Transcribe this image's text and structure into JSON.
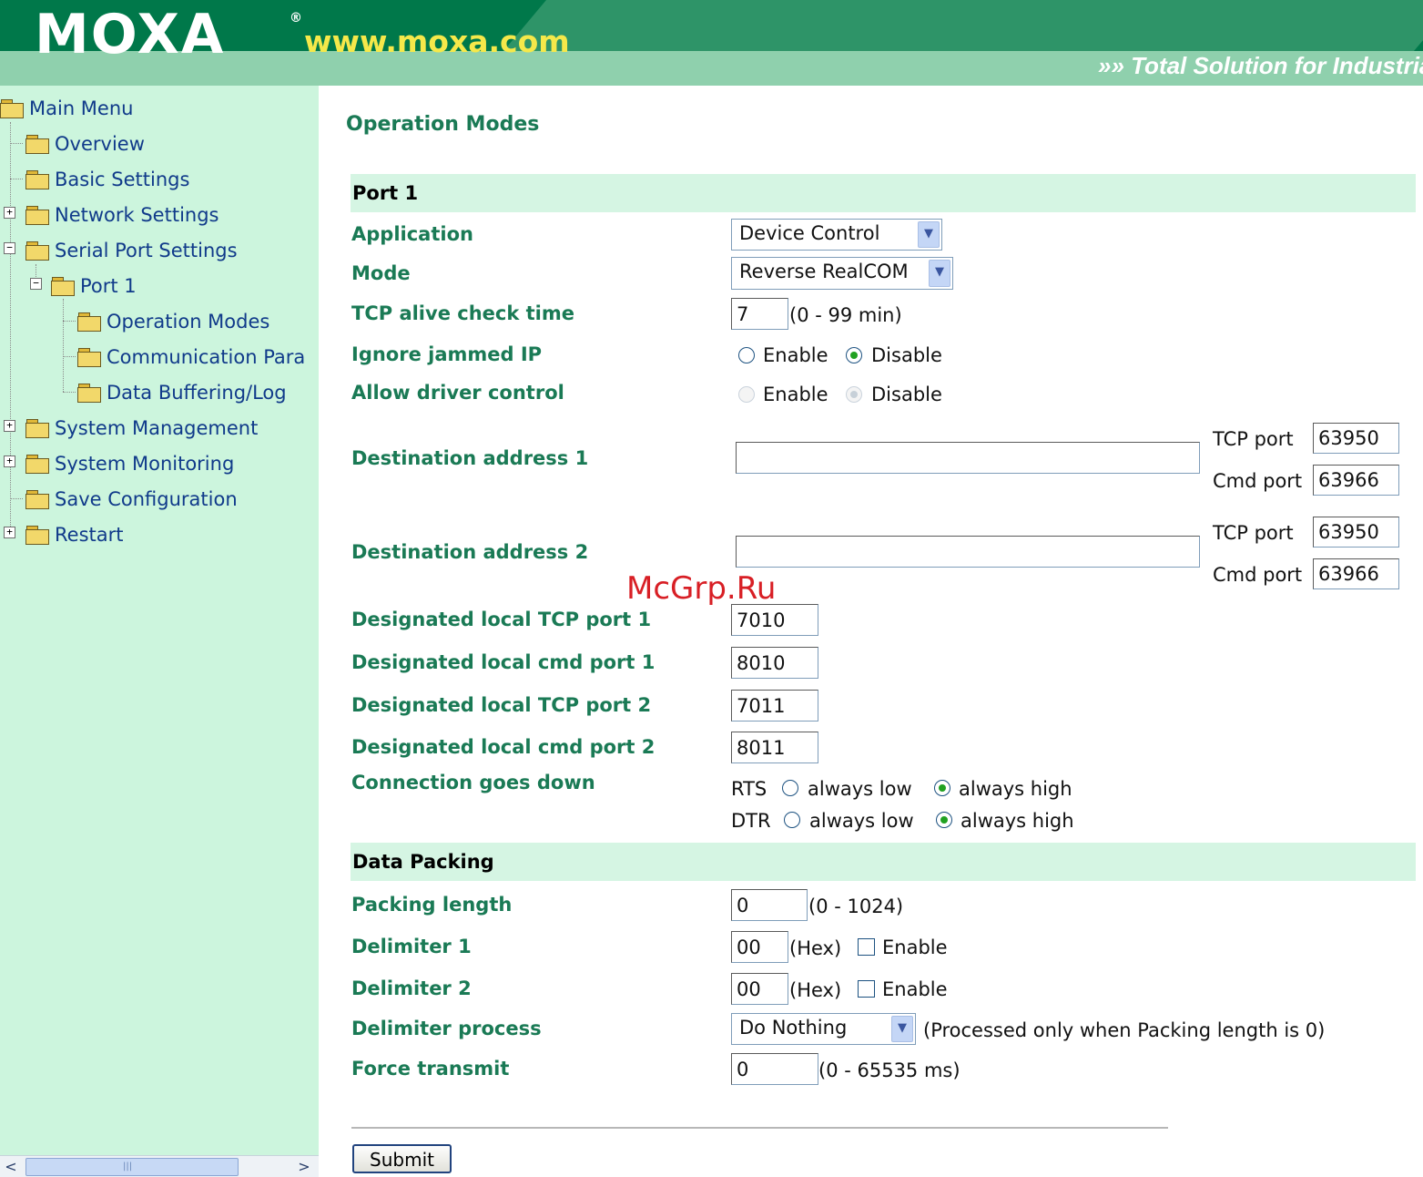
{
  "header": {
    "logo": "MOXA",
    "registered_mark": "®",
    "site_url": "www.moxa.com",
    "slogan": "»» Total Solution for Industrial"
  },
  "sidebar": {
    "items": [
      {
        "label": "Main Menu"
      },
      {
        "label": "Overview"
      },
      {
        "label": "Basic Settings"
      },
      {
        "label": "Network Settings"
      },
      {
        "label": "Serial Port Settings"
      },
      {
        "label": "Port 1"
      },
      {
        "label": "Operation Modes"
      },
      {
        "label": "Communication Para"
      },
      {
        "label": "Data Buffering/Log"
      },
      {
        "label": "System Management"
      },
      {
        "label": "System Monitoring"
      },
      {
        "label": "Save Configuration"
      },
      {
        "label": "Restart"
      }
    ],
    "expand_symbol": "+",
    "collapse_symbol": "−",
    "scroll_left": "<",
    "scroll_right": ">",
    "scroll_grip": "|||"
  },
  "main": {
    "title": "Operation Modes",
    "port_section": "Port 1",
    "application": {
      "label": "Application",
      "value": "Device Control"
    },
    "mode": {
      "label": "Mode",
      "value": "Reverse RealCOM"
    },
    "tcp_alive": {
      "label": "TCP alive check time",
      "value": "7",
      "hint": "(0 - 99 min)"
    },
    "ignore_jammed": {
      "label": "Ignore jammed IP",
      "opt1": "Enable",
      "opt2": "Disable",
      "selected": "Disable"
    },
    "allow_driver": {
      "label": "Allow driver control",
      "opt1": "Enable",
      "opt2": "Disable",
      "selected": "Disable",
      "disabled": true
    },
    "dest1": {
      "label": "Destination address 1",
      "value": "",
      "tcp_label": "TCP port",
      "tcp_value": "63950",
      "cmd_label": "Cmd port",
      "cmd_value": "63966"
    },
    "dest2": {
      "label": "Destination address 2",
      "value": "",
      "tcp_label": "TCP port",
      "tcp_value": "63950",
      "cmd_label": "Cmd port",
      "cmd_value": "63966"
    },
    "local_tcp1": {
      "label": "Designated local TCP port 1",
      "value": "7010"
    },
    "local_cmd1": {
      "label": "Designated local cmd port 1",
      "value": "8010"
    },
    "local_tcp2": {
      "label": "Designated local TCP port 2",
      "value": "7011"
    },
    "local_cmd2": {
      "label": "Designated local cmd port 2",
      "value": "8011"
    },
    "conn_down": {
      "label": "Connection goes down",
      "rts_label": "RTS",
      "dtr_label": "DTR",
      "low": "always low",
      "high": "always high",
      "rts_selected": "always high",
      "dtr_selected": "always high"
    },
    "packing_section": "Data Packing",
    "packing_length": {
      "label": "Packing length",
      "value": "0",
      "hint": "(0 - 1024)"
    },
    "delim1": {
      "label": "Delimiter 1",
      "value": "00",
      "unit": "(Hex)",
      "enable": "Enable",
      "checked": false
    },
    "delim2": {
      "label": "Delimiter 2",
      "value": "00",
      "unit": "(Hex)",
      "enable": "Enable",
      "checked": false
    },
    "delim_process": {
      "label": "Delimiter process",
      "value": "Do Nothing",
      "hint": "(Processed only when Packing length is 0)"
    },
    "force_transmit": {
      "label": "Force transmit",
      "value": "0",
      "hint": "(0 - 65535 ms)"
    },
    "submit": "Submit"
  },
  "watermark": "McGrp.Ru",
  "colors": {
    "header_dark": "#00784a",
    "header_light": "#8fd0ad",
    "url_yellow": "#f5e84a",
    "sidebar_bg": "#ccf5dd",
    "link_blue": "#103a8a",
    "label_green": "#1a7a55",
    "section_bg": "#d5f5e3",
    "watermark_red": "#d81f25"
  }
}
